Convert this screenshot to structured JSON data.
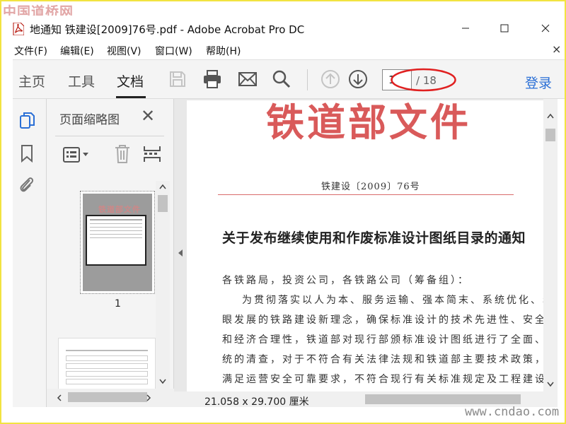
{
  "watermarks": {
    "top_left": "中国道桥网",
    "bottom_right": "www.cndao.com"
  },
  "window": {
    "title": "地通知 铁建设[2009]76号.pdf - Adobe Acrobat Pro DC",
    "controls": [
      "minimize",
      "maximize",
      "close"
    ]
  },
  "menu": {
    "items": [
      "文件(F)",
      "编辑(E)",
      "视图(V)",
      "窗口(W)",
      "帮助(H)"
    ],
    "close": "×"
  },
  "toolbar": {
    "tabs": [
      "主页",
      "工具",
      "文档"
    ],
    "active_tab": "文档",
    "icons": [
      "save-icon",
      "print-icon",
      "email-icon",
      "search-icon",
      "page-up-icon",
      "page-down-icon"
    ],
    "page_current": "1",
    "page_total": "/ 18",
    "login": "登录",
    "accent_color": "#2a6fd6",
    "highlight_color": "#e02020"
  },
  "rail": {
    "icons": [
      "page-thumbnails-icon",
      "bookmark-icon",
      "attachment-icon"
    ]
  },
  "thumbnail_panel": {
    "title": "页面缩略图",
    "close": "✕",
    "tools": [
      "thumbnail-options-icon",
      "delete-page-icon",
      "insert-page-icon"
    ],
    "thumb_label": "1",
    "thumb1_header": "铁道部文件"
  },
  "document": {
    "header": "铁道部文件",
    "number": "铁建设〔2009〕76号",
    "title": "关于发布继续使用和作废标准设计图纸目录的通知",
    "salutation": "各铁路局，投资公司，各铁路公司（筹备组）：",
    "lines": [
      "为贯彻落实以人为本、服务运输、强本简末、系统优化、着",
      "眼发展的铁路建设新理念，确保标准设计的技术先进性、安全性",
      "和经济合理性，铁道部对现行部颁标准设计图纸进行了全面、系",
      "统的清查，对于不符合有关法律法规和铁道部主要技术政策，不",
      "满足运营安全可靠要求，不符合现行有关标准规定及工程建设中"
    ],
    "header_color": "#d95a5a"
  },
  "status": {
    "page_size": "21.058 x 29.700 厘米"
  }
}
